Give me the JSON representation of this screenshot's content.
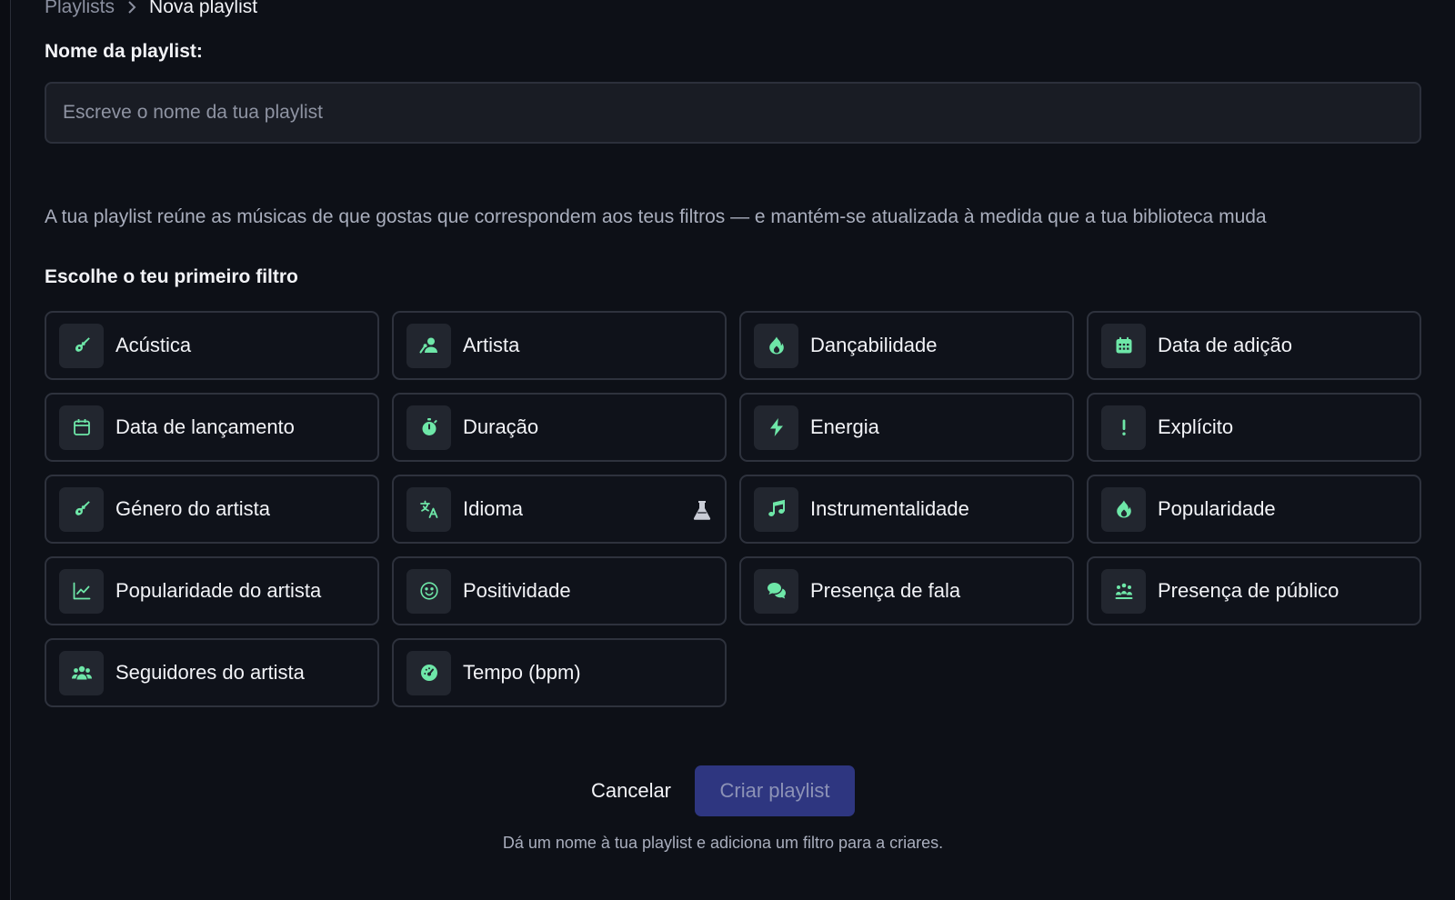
{
  "breadcrumb": {
    "parent": "Playlists",
    "current": "Nova playlist"
  },
  "form": {
    "name_label": "Nome da playlist:",
    "name_placeholder": "Escreve o nome da tua playlist",
    "name_value": "",
    "description": "A tua playlist reúne as músicas de que gostas que correspondem aos teus filtros — e mantém-se atualizada à medida que a tua biblioteca muda",
    "filters_heading": "Escolhe o teu primeiro filtro"
  },
  "filters": [
    {
      "label": "Acústica",
      "icon": "guitar-icon"
    },
    {
      "label": "Artista",
      "icon": "artist-icon"
    },
    {
      "label": "Dançabilidade",
      "icon": "fire-icon"
    },
    {
      "label": "Data de adição",
      "icon": "calendar-filled-icon"
    },
    {
      "label": "Data de lançamento",
      "icon": "calendar-outline-icon"
    },
    {
      "label": "Duração",
      "icon": "stopwatch-icon"
    },
    {
      "label": "Energia",
      "icon": "bolt-icon"
    },
    {
      "label": "Explícito",
      "icon": "exclamation-icon"
    },
    {
      "label": "Género do artista",
      "icon": "guitar-icon"
    },
    {
      "label": "Idioma",
      "icon": "translate-icon",
      "badge": "flask-icon"
    },
    {
      "label": "Instrumentalidade",
      "icon": "music-note-icon"
    },
    {
      "label": "Popularidade",
      "icon": "fire-icon"
    },
    {
      "label": "Popularidade do artista",
      "icon": "line-chart-icon"
    },
    {
      "label": "Positividade",
      "icon": "smile-icon"
    },
    {
      "label": "Presença de fala",
      "icon": "chat-bubbles-icon"
    },
    {
      "label": "Presença de público",
      "icon": "audience-icon"
    },
    {
      "label": "Seguidores do artista",
      "icon": "users-icon"
    },
    {
      "label": "Tempo (bpm)",
      "icon": "gauge-icon"
    }
  ],
  "actions": {
    "cancel_label": "Cancelar",
    "create_label": "Criar playlist",
    "create_enabled": false,
    "hint": "Dá um nome à tua playlist e adiciona um filtro para a criares."
  },
  "colors": {
    "background": "#0d1017",
    "card_border": "#2e323d",
    "icon_accent": "#6ee7a8",
    "primary_button": "#2e3680"
  }
}
